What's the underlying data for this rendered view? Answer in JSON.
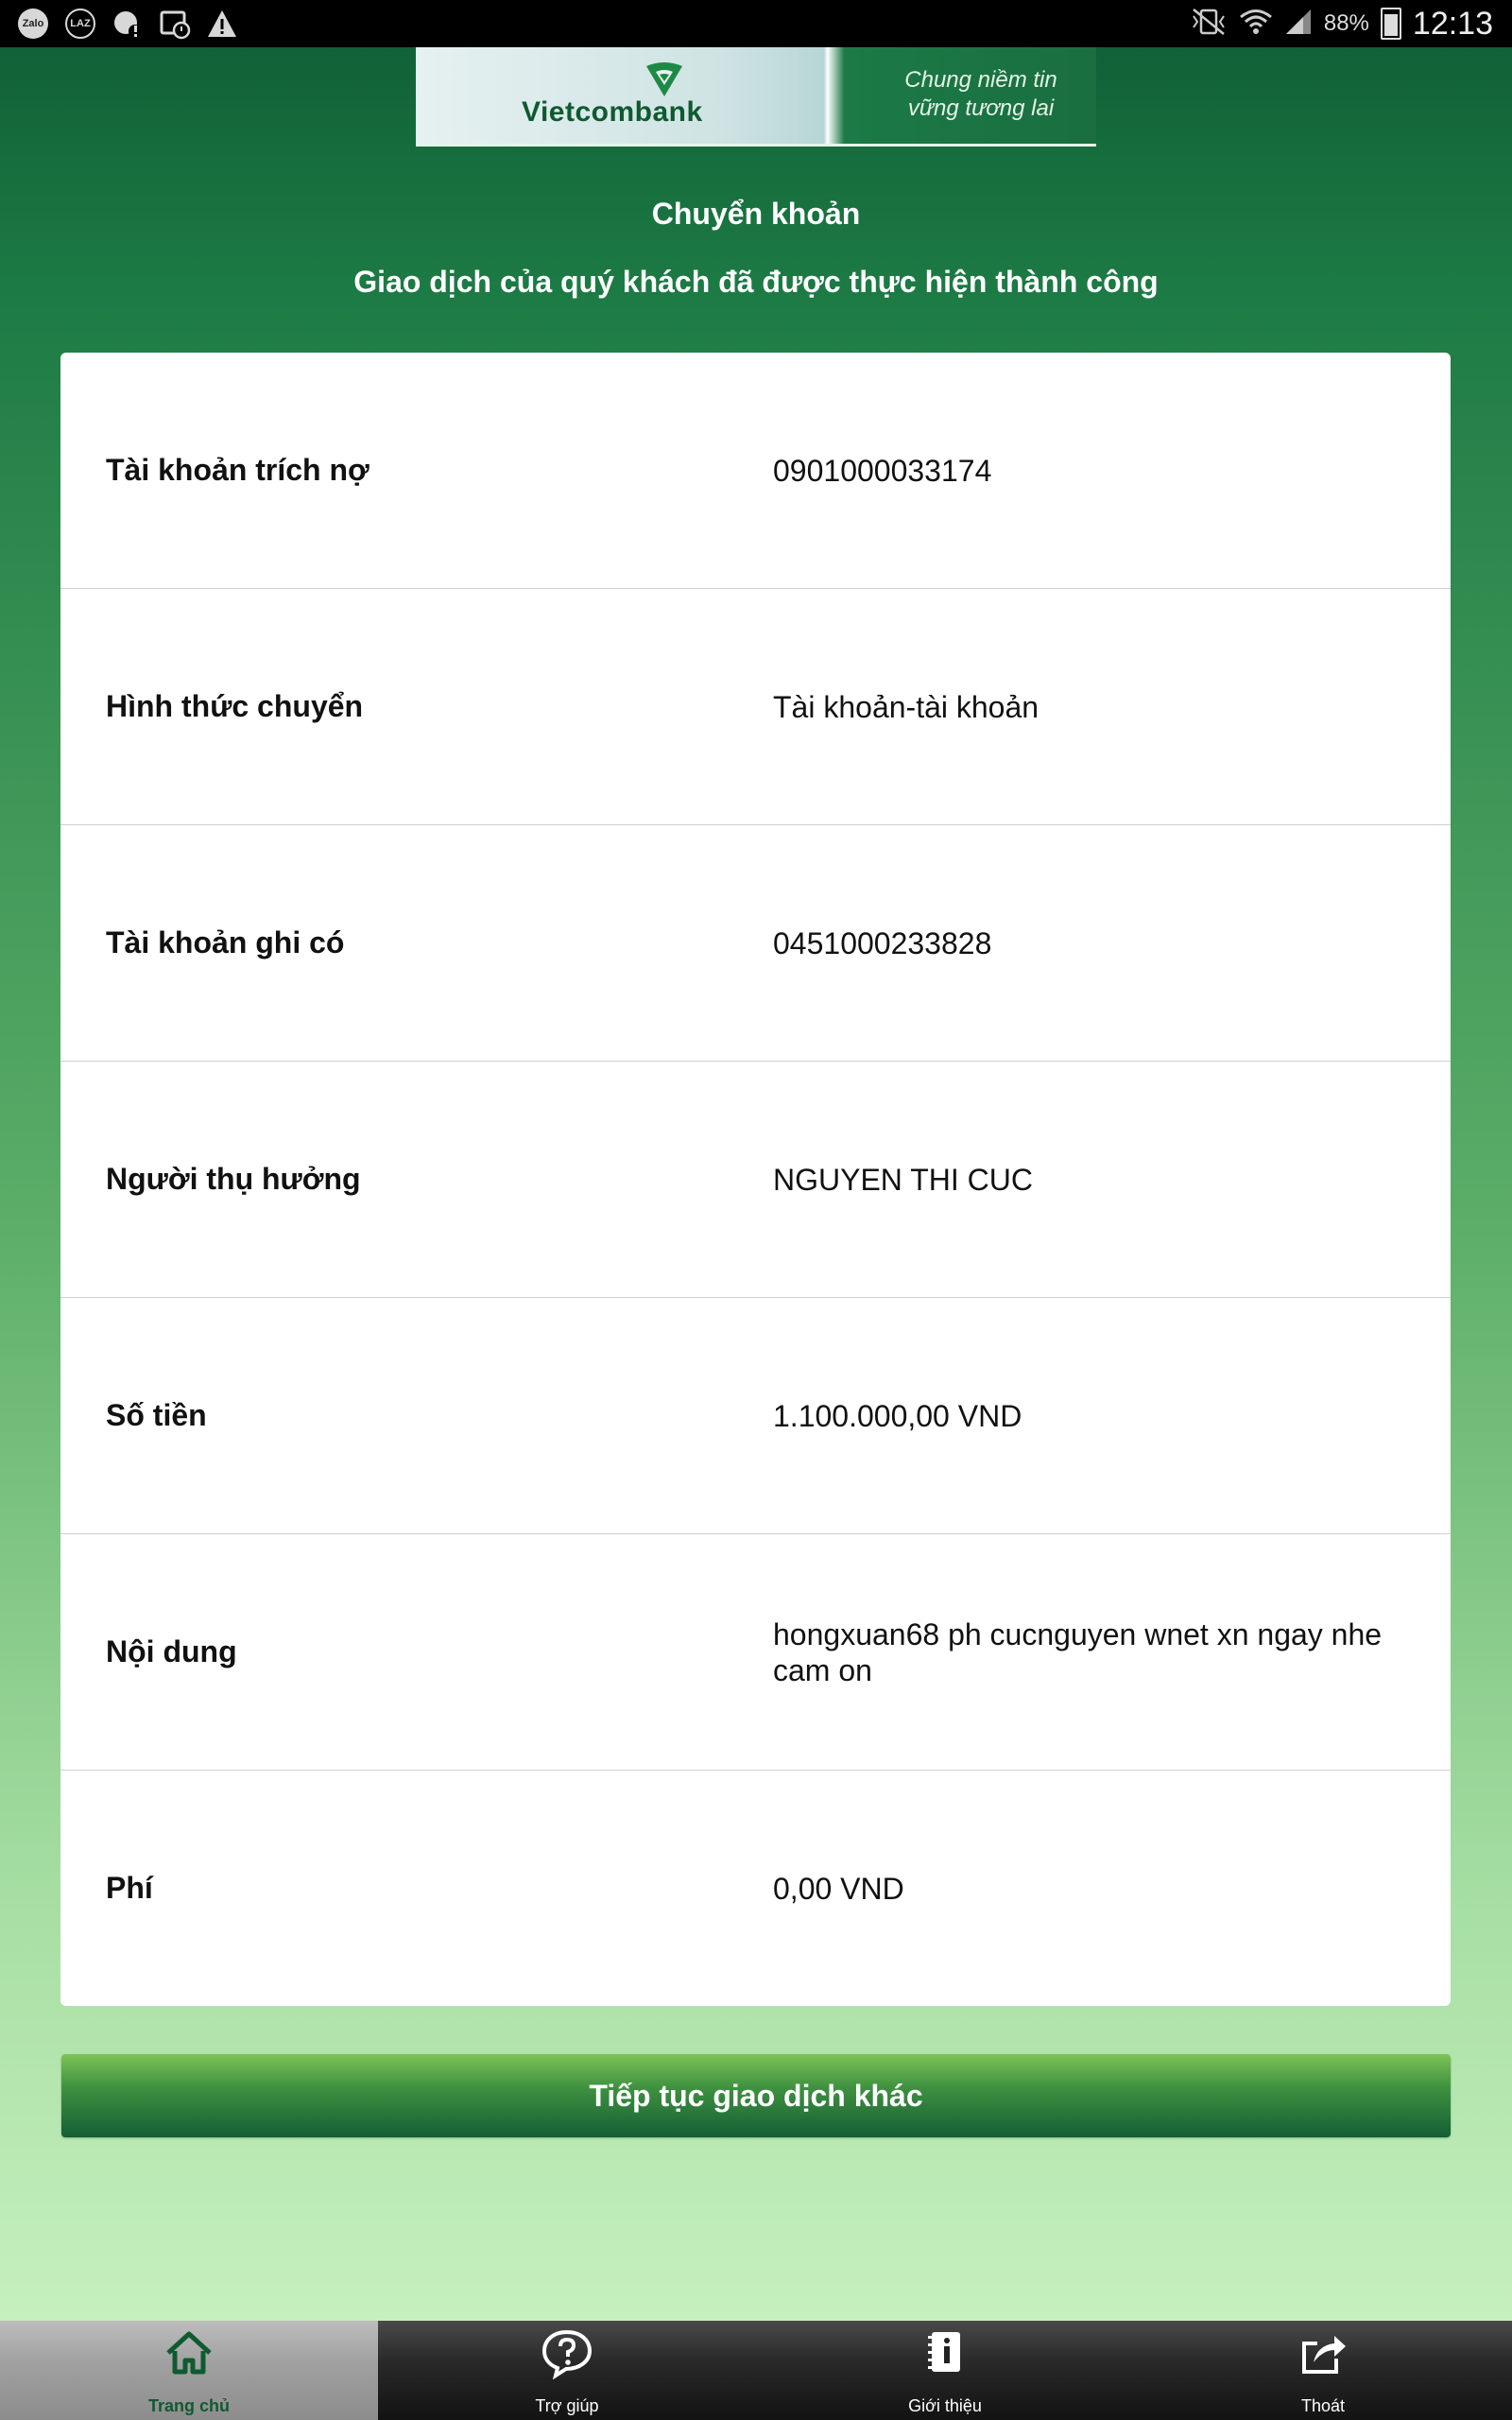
{
  "status_bar": {
    "left_icons": [
      "zalo-icon",
      "lazada-icon",
      "notification-icon",
      "clock-alarm-icon",
      "warning-icon"
    ],
    "zalo_label": "Zalo",
    "laz_label": "LAZ",
    "battery": "88%",
    "time": "12:13"
  },
  "banner": {
    "brand": "Vietcombank",
    "slogan_line1": "Chung niềm tin",
    "slogan_line2": "vững tương lai",
    "brand_color": "#0f5a30"
  },
  "header": {
    "title": "Chuyển khoản",
    "subtitle": "Giao dịch của quý khách đã được thực hiện thành công"
  },
  "details": [
    {
      "label": "Tài khoản trích nợ",
      "value": "0901000033174"
    },
    {
      "label": "Hình thức chuyển",
      "value": "Tài khoản-tài khoản"
    },
    {
      "label": "Tài khoản ghi có",
      "value": "0451000233828"
    },
    {
      "label": "Người thụ hưởng",
      "value": "NGUYEN THI CUC"
    },
    {
      "label": "Số tiền",
      "value": "1.100.000,00 VND"
    },
    {
      "label": "Nội dung",
      "value": "hongxuan68 ph cucnguyen wnet xn ngay nhe cam on"
    },
    {
      "label": "Phí",
      "value": "0,00 VND"
    }
  ],
  "continue_button": {
    "label": "Tiếp tục giao dịch khác"
  },
  "bottom_nav": [
    {
      "label": "Trang chủ",
      "icon": "home-icon",
      "active": true
    },
    {
      "label": "Trợ giúp",
      "icon": "help-icon",
      "active": false
    },
    {
      "label": "Giới thiệu",
      "icon": "info-icon",
      "active": false
    },
    {
      "label": "Thoát",
      "icon": "logout-icon",
      "active": false
    }
  ],
  "colors": {
    "accent_green": "#0e5c34",
    "button_top": "#7dc356",
    "button_bottom": "#145f35"
  }
}
